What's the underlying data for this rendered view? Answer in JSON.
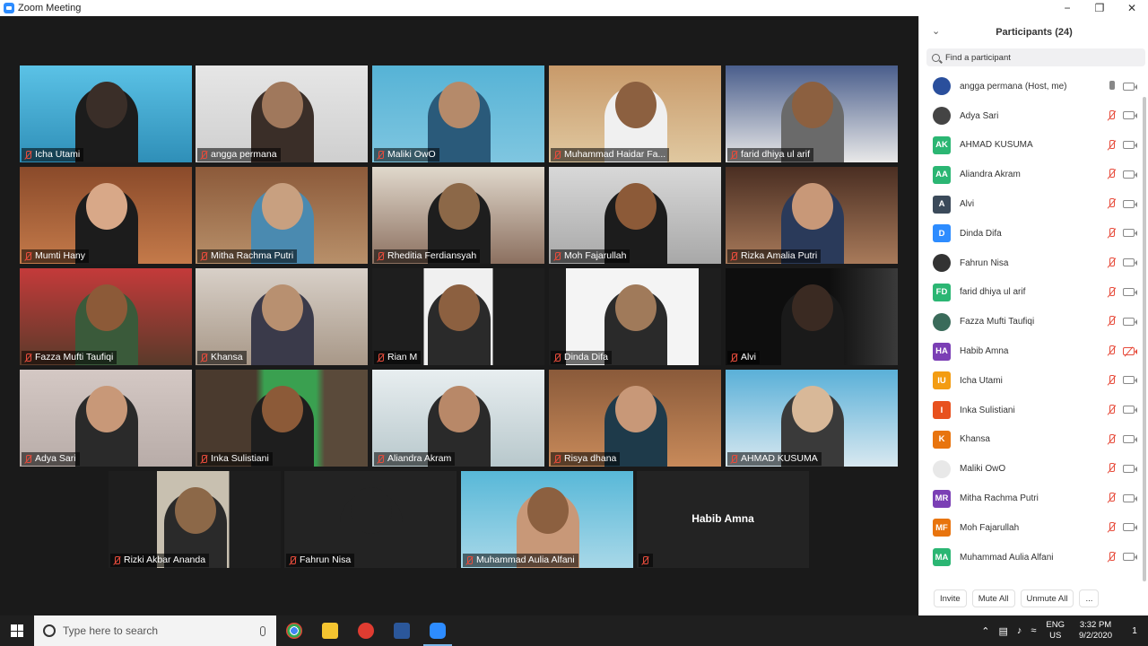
{
  "window": {
    "title": "Zoom Meeting",
    "minimize": "−",
    "restore": "❐",
    "close": "✕"
  },
  "tiles": [
    {
      "name": "Icha Utami"
    },
    {
      "name": "angga permana"
    },
    {
      "name": "Maliki OwO"
    },
    {
      "name": "Muhammad Haidar Fa..."
    },
    {
      "name": "farid dhiya ul arif"
    },
    {
      "name": "Mumti Hany"
    },
    {
      "name": "Mitha Rachma Putri"
    },
    {
      "name": "Rheditia Ferdiansyah"
    },
    {
      "name": "Moh Fajarullah"
    },
    {
      "name": "Rizka Amalia Putri"
    },
    {
      "name": "Fazza Mufti Taufiqi"
    },
    {
      "name": "Khansa"
    },
    {
      "name": "Rian M"
    },
    {
      "name": "Dinda Difa"
    },
    {
      "name": "Alvi"
    },
    {
      "name": "Adya Sari"
    },
    {
      "name": "Inka Sulistiani"
    },
    {
      "name": "Aliandra Akram"
    },
    {
      "name": "Risya dhana"
    },
    {
      "name": "AHMAD KUSUMA"
    },
    {
      "name": "Rizki Akbar Ananda"
    },
    {
      "name": "Fahrun Nisa"
    },
    {
      "name": "Muhammad Aulia Alfani"
    },
    {
      "name": "",
      "label": "Habib Amna"
    }
  ],
  "participants": {
    "title": "Participants (24)",
    "collapse_icon": "⌄",
    "search_placeholder": "Find a participant",
    "list": [
      {
        "name": "angga permana (Host, me)",
        "initials": "",
        "color": "#2a4f9c",
        "mic": "on",
        "cam": "on"
      },
      {
        "name": "Adya Sari",
        "initials": "",
        "color": "#444444",
        "mic": "off",
        "cam": "on"
      },
      {
        "name": "AHMAD KUSUMA",
        "initials": "AK",
        "color": "#2bb673",
        "mic": "off",
        "cam": "on"
      },
      {
        "name": "Aliandra Akram",
        "initials": "AA",
        "color": "#2bb673",
        "mic": "off",
        "cam": "on"
      },
      {
        "name": "Alvi",
        "initials": "A",
        "color": "#3b4a5a",
        "mic": "off",
        "cam": "on"
      },
      {
        "name": "Dinda Difa",
        "initials": "D",
        "color": "#2d8cff",
        "mic": "off",
        "cam": "on"
      },
      {
        "name": "Fahrun Nisa",
        "initials": "",
        "color": "#333333",
        "mic": "off",
        "cam": "on"
      },
      {
        "name": "farid dhiya ul arif",
        "initials": "FD",
        "color": "#2bb673",
        "mic": "off",
        "cam": "on"
      },
      {
        "name": "Fazza Mufti Taufiqi",
        "initials": "",
        "color": "#3a6b5a",
        "mic": "off",
        "cam": "on"
      },
      {
        "name": "Habib Amna",
        "initials": "HA",
        "color": "#7b3fb5",
        "mic": "off",
        "cam": "off"
      },
      {
        "name": "Icha Utami",
        "initials": "IU",
        "color": "#f39c12",
        "mic": "off",
        "cam": "on"
      },
      {
        "name": "Inka Sulistiani",
        "initials": "I",
        "color": "#e8511e",
        "mic": "off",
        "cam": "on"
      },
      {
        "name": "Khansa",
        "initials": "K",
        "color": "#e8740e",
        "mic": "off",
        "cam": "on"
      },
      {
        "name": "Maliki OwO",
        "initials": "",
        "color": "#e8e8e8",
        "mic": "off",
        "cam": "on"
      },
      {
        "name": "Mitha Rachma Putri",
        "initials": "MR",
        "color": "#7b3fb5",
        "mic": "off",
        "cam": "on"
      },
      {
        "name": "Moh Fajarullah",
        "initials": "MF",
        "color": "#e8740e",
        "mic": "off",
        "cam": "on"
      },
      {
        "name": "Muhammad Aulia Alfani",
        "initials": "MA",
        "color": "#2bb673",
        "mic": "off",
        "cam": "on"
      }
    ],
    "footer": {
      "invite": "Invite",
      "mute_all": "Mute All",
      "unmute_all": "Unmute All",
      "more": "..."
    }
  },
  "taskbar": {
    "search_placeholder": "Type here to search",
    "lang_top": "ENG",
    "lang_bottom": "US",
    "time": "3:32 PM",
    "date": "9/2/2020",
    "notifications": "1"
  }
}
